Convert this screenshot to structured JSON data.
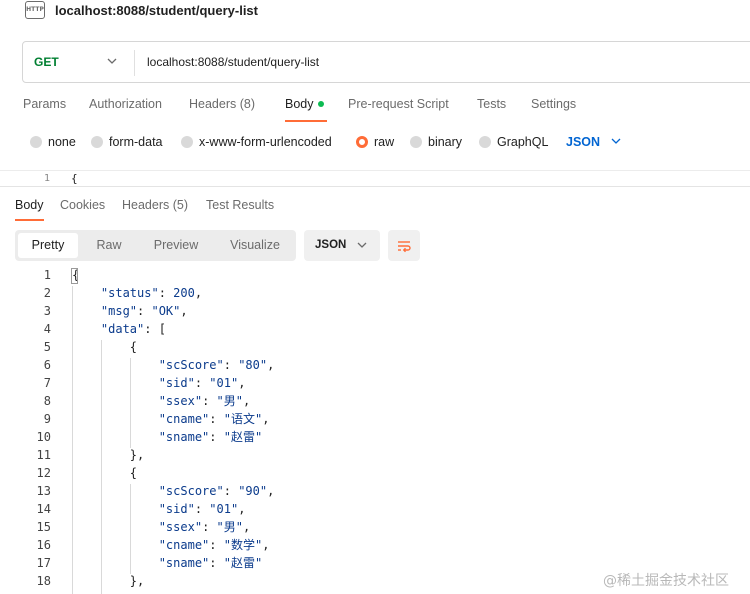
{
  "title": {
    "icon_label": "HTTP",
    "text": "localhost:8088/student/query-list"
  },
  "request": {
    "method": "GET",
    "url": "localhost:8088/student/query-list",
    "tabs": [
      {
        "label": "Params"
      },
      {
        "label": "Authorization"
      },
      {
        "label": "Headers (8)"
      },
      {
        "label": "Body",
        "active": true
      },
      {
        "label": "Pre-request Script"
      },
      {
        "label": "Tests"
      },
      {
        "label": "Settings"
      }
    ],
    "body_types": [
      {
        "label": "none"
      },
      {
        "label": "form-data"
      },
      {
        "label": "x-www-form-urlencoded"
      },
      {
        "label": "raw",
        "selected": true
      },
      {
        "label": "binary"
      },
      {
        "label": "GraphQL"
      }
    ],
    "raw_format": "JSON",
    "editor_first_line": {
      "num": "1",
      "text": "{"
    }
  },
  "response": {
    "tabs": [
      {
        "label": "Body",
        "active": true
      },
      {
        "label": "Cookies"
      },
      {
        "label": "Headers (5)"
      },
      {
        "label": "Test Results"
      }
    ],
    "views": [
      "Pretty",
      "Raw",
      "Preview",
      "Visualize"
    ],
    "active_view": "Pretty",
    "format": "JSON",
    "code_lines": [
      "{",
      "    \"status\": 200,",
      "    \"msg\": \"OK\",",
      "    \"data\": [",
      "        {",
      "            \"scScore\": \"80\",",
      "            \"sid\": \"01\",",
      "            \"ssex\": \"男\",",
      "            \"cname\": \"语文\",",
      "            \"sname\": \"赵雷\"",
      "        },",
      "        {",
      "            \"scScore\": \"90\",",
      "            \"sid\": \"01\",",
      "            \"ssex\": \"男\",",
      "            \"cname\": \"数学\",",
      "            \"sname\": \"赵雷\"",
      "        },"
    ]
  },
  "watermark": "@稀土掘金技术社区",
  "colors": {
    "accent": "#ff6c37",
    "method_get": "#007f31",
    "link_blue": "#0265d2",
    "active_dot": "#0cbb52"
  }
}
